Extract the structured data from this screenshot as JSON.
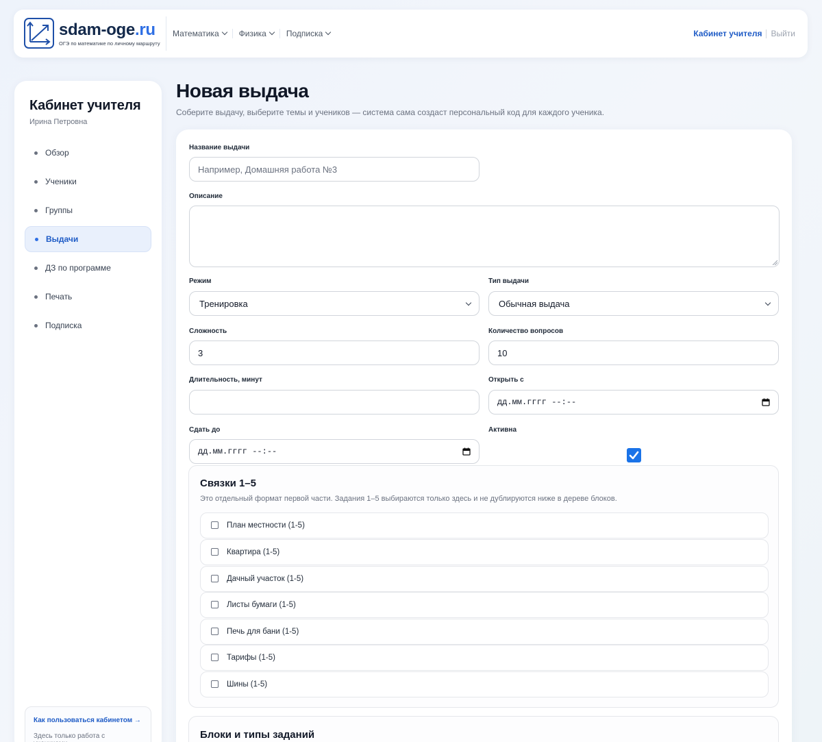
{
  "header": {
    "logo_title": "sdam-oge",
    "logo_tld": ".ru",
    "logo_subtitle": "ОГЭ по математике по личному маршруту",
    "nav": [
      {
        "label": "Математика"
      },
      {
        "label": "Физика"
      },
      {
        "label": "Подписка"
      }
    ],
    "cabinet_label": "Кабинет учителя",
    "logout_label": "Выйти",
    "accent_color": "#1e5bc6"
  },
  "sidebar": {
    "title": "Кабинет учителя",
    "user": "Ирина Петровна",
    "items": [
      {
        "label": "Обзор",
        "active": false
      },
      {
        "label": "Ученики",
        "active": false
      },
      {
        "label": "Группы",
        "active": false
      },
      {
        "label": "Выдачи",
        "active": true
      },
      {
        "label": "ДЗ по программе",
        "active": false
      },
      {
        "label": "Печать",
        "active": false
      },
      {
        "label": "Подписка",
        "active": false
      }
    ],
    "help_link": "Как пользоваться кабинетом →",
    "help_text": "Здесь только работа с учениками,"
  },
  "main": {
    "title": "Новая выдача",
    "subtitle": "Соберите выдачу, выберите темы и учеников — система сама создаст персональный код для каждого ученика.",
    "form": {
      "name_label": "Название выдачи",
      "name_placeholder": "Например, Домашняя работа №3",
      "name_value": "",
      "description_label": "Описание",
      "description_value": "",
      "mode_label": "Режим",
      "mode_value": "Тренировка",
      "type_label": "Тип выдачи",
      "type_value": "Обычная выдача",
      "difficulty_label": "Сложность",
      "difficulty_value": "3",
      "questions_label": "Количество вопросов",
      "questions_value": "10",
      "duration_label": "Длительность, минут",
      "duration_value": "",
      "open_label": "Открыть с",
      "open_value": "дд.мм.гггг --:--",
      "due_label": "Сдать до",
      "due_value": "дд.мм.гггг --:--",
      "active_label": "Активна",
      "active_checked": true
    },
    "links_section": {
      "title": "Связки 1–5",
      "description": "Это отдельный формат первой части. Задания 1–5 выбираются только здесь и не дублируются ниже в дереве блоков.",
      "options": [
        {
          "label": "План местности (1-5)",
          "checked": false
        },
        {
          "label": "Квартира (1-5)",
          "checked": false
        },
        {
          "label": "Дачный участок (1-5)",
          "checked": false
        },
        {
          "label": "Листы бумаги (1-5)",
          "checked": false
        },
        {
          "label": "Печь для бани (1-5)",
          "checked": false
        },
        {
          "label": "Тарифы (1-5)",
          "checked": false
        },
        {
          "label": "Шины (1-5)",
          "checked": false
        }
      ]
    },
    "blocks_section": {
      "title": "Блоки и типы заданий"
    }
  }
}
